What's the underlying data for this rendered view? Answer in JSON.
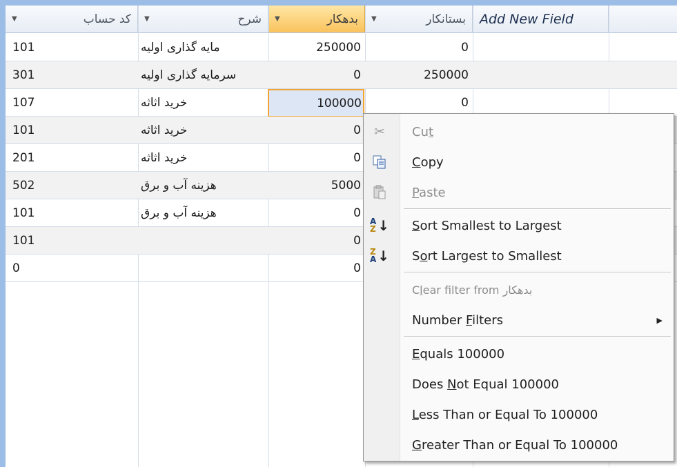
{
  "columns": {
    "code": "کد حساب",
    "description": "شرح",
    "debit": "بدهکار",
    "credit": "بستانکار",
    "add_new_field": "Add New Field"
  },
  "rows": [
    {
      "code": "101",
      "description": "مایه گذاری اولیه",
      "debit": "250000",
      "credit": "0"
    },
    {
      "code": "301",
      "description": "سرمایه گذاری اولیه",
      "debit": "0",
      "credit": "250000"
    },
    {
      "code": "107",
      "description": "خرید اثاثه",
      "debit": "100000",
      "credit": "0"
    },
    {
      "code": "101",
      "description": "خرید اثاثه",
      "debit": "0",
      "credit": ""
    },
    {
      "code": "201",
      "description": "خرید اثاثه",
      "debit": "0",
      "credit": ""
    },
    {
      "code": "502",
      "description": "هزینه آب و برق",
      "debit": "5000",
      "credit": ""
    },
    {
      "code": "101",
      "description": "هزینه آب و برق",
      "debit": "0",
      "credit": ""
    },
    {
      "code": "101",
      "description": "",
      "debit": "0",
      "credit": ""
    },
    {
      "code": "0",
      "description": "",
      "debit": "0",
      "credit": ""
    }
  ],
  "menu": {
    "cut": {
      "pre": "Cu",
      "key": "t",
      "post": ""
    },
    "copy": {
      "pre": "",
      "key": "C",
      "post": "opy"
    },
    "paste": {
      "pre": "",
      "key": "P",
      "post": "aste"
    },
    "sort_asc": {
      "pre": "",
      "key": "S",
      "post": "ort Smallest to Largest"
    },
    "sort_desc": {
      "pre": "S",
      "key": "o",
      "post": "rt Largest to Smallest"
    },
    "clear_filter": {
      "pre": "C",
      "key": "l",
      "post": "ear filter from بدهکار"
    },
    "number_filters": {
      "pre": "Number ",
      "key": "F",
      "post": "ilters"
    },
    "equals": {
      "pre": "",
      "key": "E",
      "post": "quals 100000"
    },
    "not_equal": {
      "pre": "Does ",
      "key": "N",
      "post": "ot Equal 100000"
    },
    "lte": {
      "pre": "",
      "key": "L",
      "post": "ess Than or Equal To 100000"
    },
    "gte": {
      "pre": "",
      "key": "G",
      "post": "reater Than or Equal To 100000"
    }
  },
  "icons": {
    "cut": "scissors-icon",
    "copy": "copy-icon",
    "paste": "paste-icon",
    "sort_asc": "sort-a-z-icon",
    "sort_desc": "sort-z-a-icon",
    "submenu": "submenu-arrow-icon",
    "column_dropdown": "dropdown-arrow-icon"
  },
  "colors": {
    "selected_header": "#f9c25c",
    "focus_border": "#f2a531",
    "window_frame": "#9bbde6"
  }
}
